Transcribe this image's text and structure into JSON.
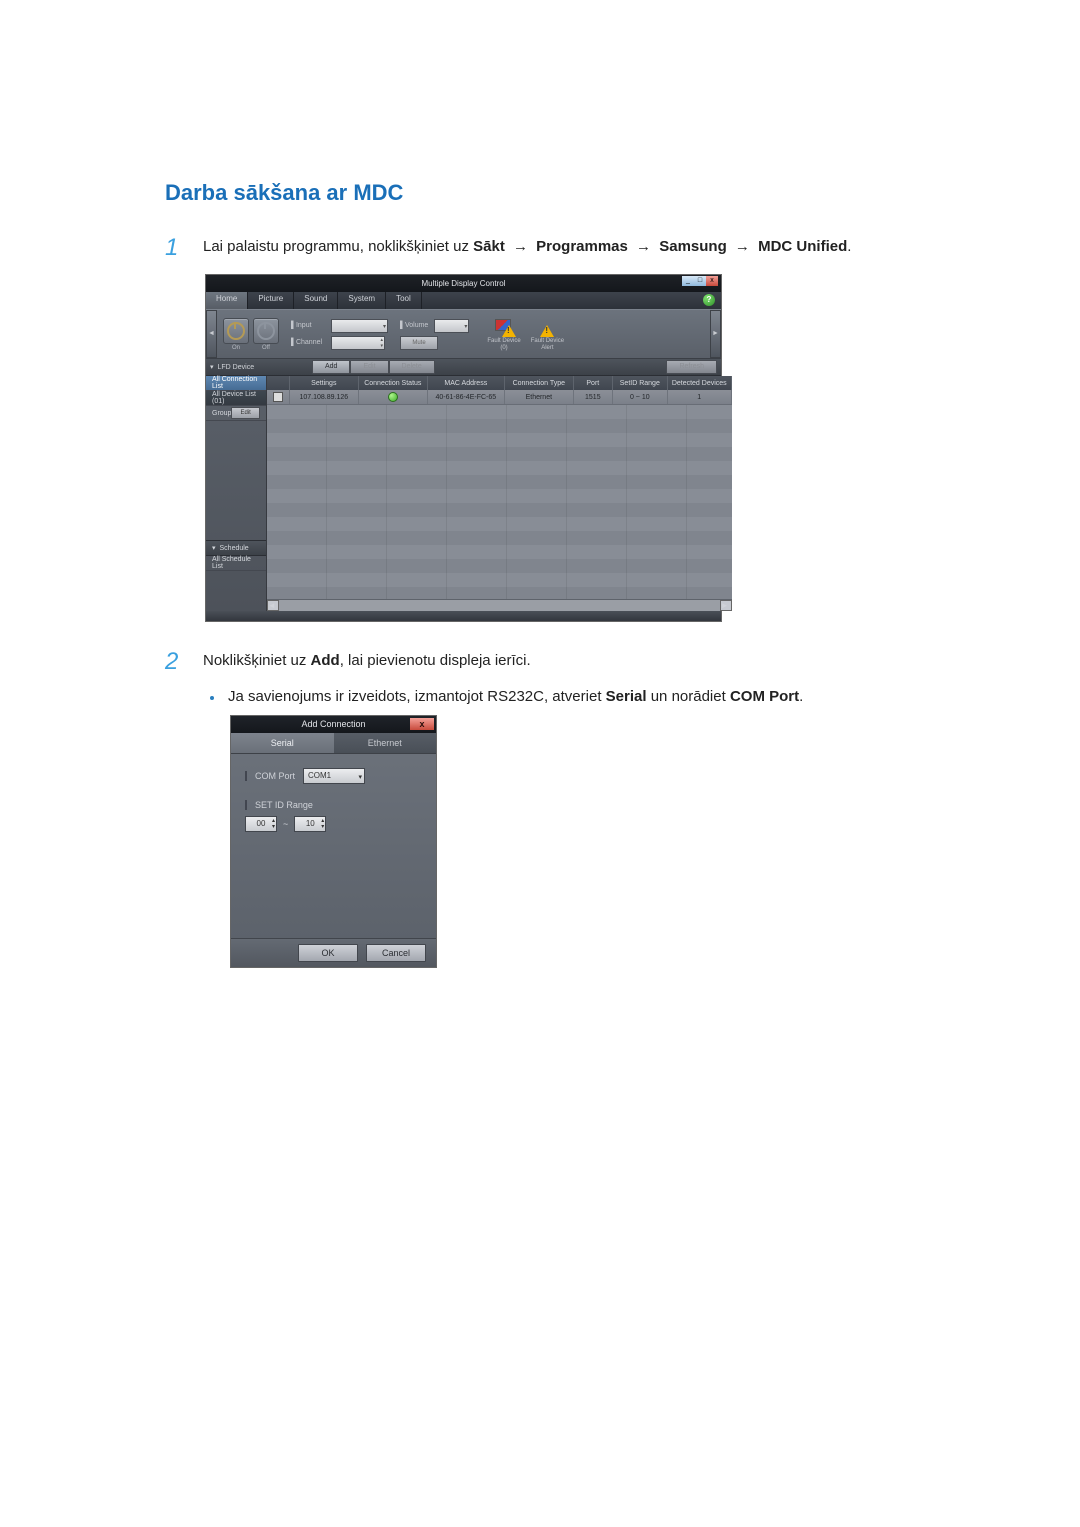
{
  "section_title": "Darba sākšana ar MDC",
  "steps": {
    "s1_num": "1",
    "s1_lead": "Lai palaistu programmu, noklikšķiniet uz ",
    "s1_p1": "Sākt",
    "s1_p2": "Programmas",
    "s1_p3": "Samsung",
    "s1_p4": "MDC Unified",
    "arrow": "→",
    "s2_num": "2",
    "s2_lead": "Noklikšķiniet uz ",
    "s2_bold": "Add",
    "s2_tail": ", lai pievienotu displeja ierīci.",
    "bullet_lead": "Ja savienojums ir izveidots, izmantojot RS232C, atveriet ",
    "bullet_b1": "Serial",
    "bullet_mid": " un norādiet ",
    "bullet_b2": "COM Port",
    "dot": "."
  },
  "mdc": {
    "title": "Multiple Display Control",
    "menu": {
      "home": "Home",
      "picture": "Picture",
      "sound": "Sound",
      "system": "System",
      "tool": "Tool"
    },
    "help_badge": "?",
    "win": {
      "min": "_",
      "max": "□",
      "close": "x"
    },
    "toolbar": {
      "on_sub": "On",
      "off_sub": "Off",
      "input_lbl": "Input",
      "channel_lbl": "Channel",
      "volume_lbl": "Volume",
      "mute_btn": "Mute",
      "fault_device": "Fault Device",
      "fault_count": "(0)",
      "fault_alert": "Fault Device",
      "fault_alert2": "Alert"
    },
    "action": {
      "lfd_head": "LFD Device",
      "add": "Add",
      "edit": "Edit",
      "delete": "Delete",
      "refresh": "Refresh"
    },
    "side": {
      "all_conn": "All Connection List",
      "all_dev": "All Device List (01)",
      "group": "Group",
      "edit": "Edit",
      "schedule": "Schedule",
      "all_sched": "All Schedule List"
    },
    "table": {
      "h_settings": "Settings",
      "h_cs": "Connection Status",
      "h_mac": "MAC Address",
      "h_ct": "Connection Type",
      "h_port": "Port",
      "h_range": "SetID Range",
      "h_det": "Detected Devices",
      "r_ip": "107.108.89.126",
      "r_mac": "40-61-86-4E-FC-65",
      "r_ct": "Ethernet",
      "r_port": "1515",
      "r_range": "0 ~ 10",
      "r_det": "1"
    }
  },
  "dialog": {
    "title": "Add Connection",
    "close": "x",
    "tab_serial": "Serial",
    "tab_eth": "Ethernet",
    "com_port_lbl": "COM Port",
    "com_port_val": "COM1",
    "set_id_lbl": "SET ID Range",
    "range_from": "00",
    "range_sep": "~",
    "range_to": "10",
    "ok": "OK",
    "cancel": "Cancel"
  }
}
